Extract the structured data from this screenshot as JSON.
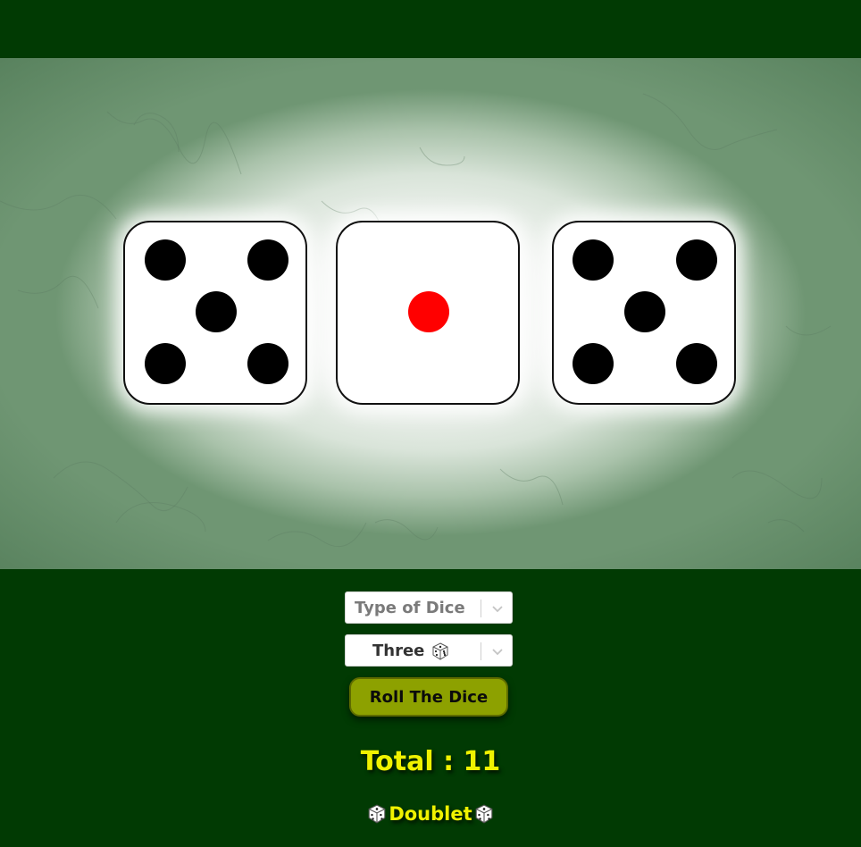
{
  "dice": [
    {
      "value": 5,
      "pip_color": "#000000"
    },
    {
      "value": 1,
      "pip_color": "#ff0000"
    },
    {
      "value": 5,
      "pip_color": "#000000"
    }
  ],
  "controls": {
    "type_select": {
      "value": "Type of Dice",
      "icon": "chevron-down-icon"
    },
    "count_select": {
      "value": "Three",
      "icon": "dice-icon"
    },
    "roll_button": "Roll The Dice"
  },
  "total_label": "Total : 11",
  "result_label": "Doublet",
  "colors": {
    "background": "#013a03",
    "button": "#8da100",
    "total_text": "#f0f200"
  }
}
